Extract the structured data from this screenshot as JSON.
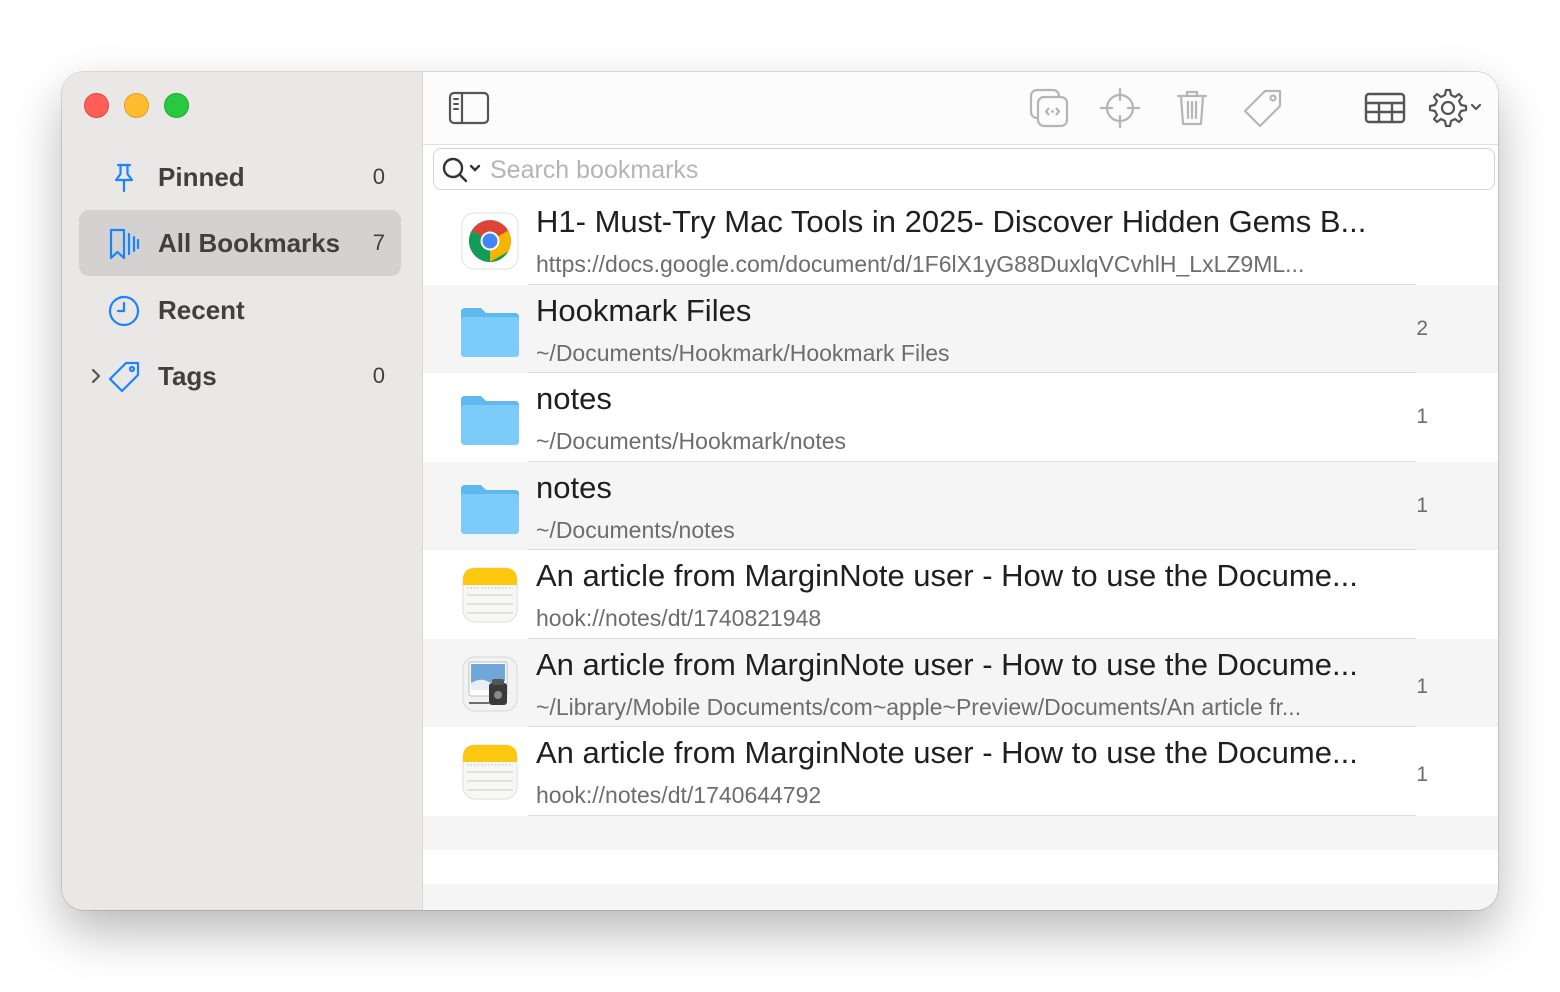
{
  "sidebar": {
    "items": [
      {
        "label": "Pinned",
        "count": "0",
        "icon": "pin-icon"
      },
      {
        "label": "All Bookmarks",
        "count": "7",
        "icon": "bookmarks-icon"
      },
      {
        "label": "Recent",
        "count": "",
        "icon": "clock-icon"
      },
      {
        "label": "Tags",
        "count": "0",
        "icon": "tag-icon"
      }
    ]
  },
  "toolbar": {
    "icons": [
      "sidebar-toggle-icon",
      "copy-link-icon",
      "reveal-crosshair-icon",
      "trash-icon",
      "tag-icon",
      "table-view-icon",
      "gear-icon"
    ]
  },
  "search": {
    "placeholder": "Search bookmarks",
    "value": ""
  },
  "bookmarks": [
    {
      "title": "H1- Must-Try Mac Tools in 2025- Discover Hidden Gems B...",
      "subtitle": "https://docs.google.com/document/d/1F6lX1yG88DuxlqVCvhlH_LxLZ9ML...",
      "count": "",
      "icon": "chrome-icon"
    },
    {
      "title": "Hookmark Files",
      "subtitle": "~/Documents/Hookmark/Hookmark Files",
      "count": "2",
      "icon": "folder-icon"
    },
    {
      "title": "notes",
      "subtitle": "~/Documents/Hookmark/notes",
      "count": "1",
      "icon": "folder-icon"
    },
    {
      "title": "notes",
      "subtitle": "~/Documents/notes",
      "count": "1",
      "icon": "folder-icon"
    },
    {
      "title": "An article from MarginNote user - How to use the Docume...",
      "subtitle": "hook://notes/dt/1740821948",
      "count": "",
      "icon": "notes-app-icon"
    },
    {
      "title": "An article from MarginNote user - How to use the Docume...",
      "subtitle": "~/Library/Mobile Documents/com~apple~Preview/Documents/An article fr...",
      "count": "1",
      "icon": "preview-app-icon"
    },
    {
      "title": "An article from MarginNote user - How to use the Docume...",
      "subtitle": "hook://notes/dt/1740644792",
      "count": "1",
      "icon": "notes-app-icon"
    }
  ],
  "colors": {
    "accent": "#1a84ff",
    "sidebar_bg": "#e9e8e7",
    "selected_bg": "#d3d2d1",
    "folder": "#6ec6f6"
  }
}
